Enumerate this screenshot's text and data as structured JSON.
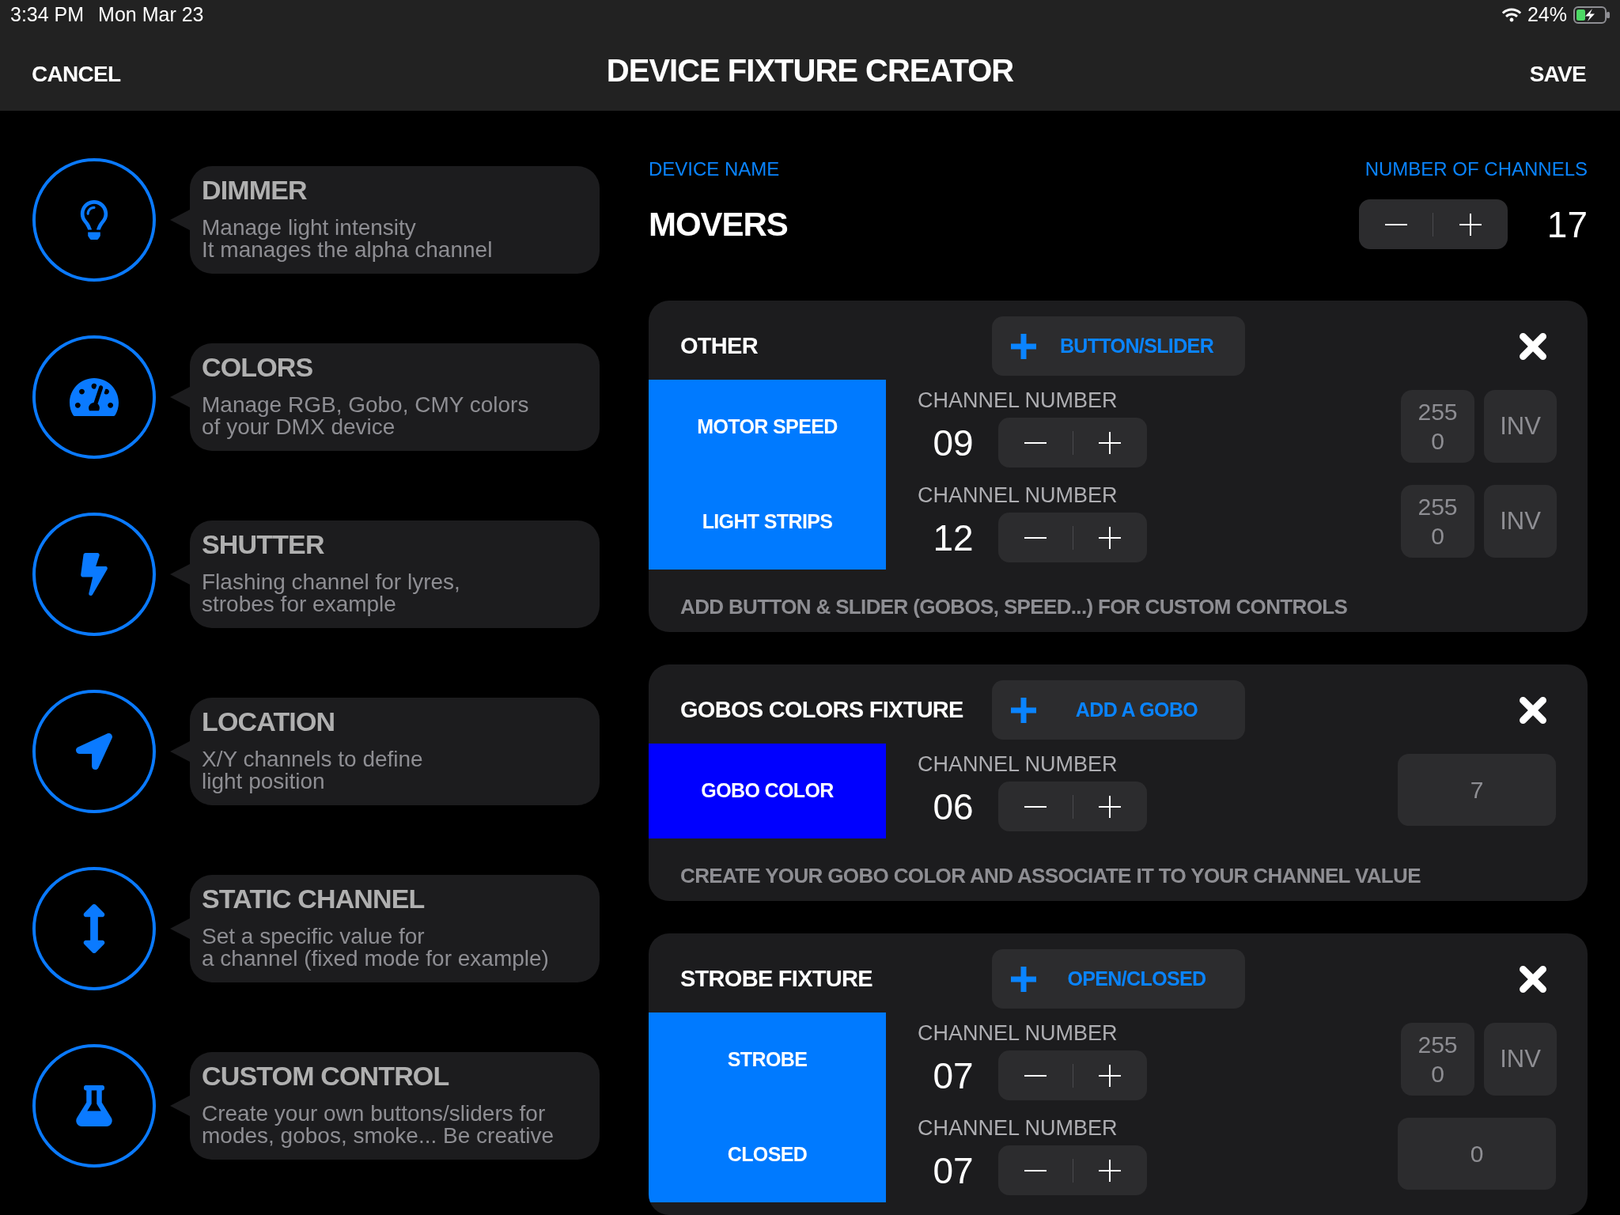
{
  "status_bar": {
    "time": "3:34 PM",
    "date": "Mon Mar 23",
    "battery": "24%"
  },
  "header": {
    "cancel": "CANCEL",
    "title": "DEVICE FIXTURE CREATOR",
    "save": "SAVE"
  },
  "sidebar": {
    "items": [
      {
        "title": "DIMMER",
        "description": "Manage light intensity\nIt manages the alpha channel"
      },
      {
        "title": "COLORS",
        "description": "Manage RGB, Gobo, CMY colors\nof your DMX device"
      },
      {
        "title": "SHUTTER",
        "description": "Flashing channel for lyres,\nstrobes for example"
      },
      {
        "title": "LOCATION",
        "description": "X/Y channels to define\nlight position"
      },
      {
        "title": "STATIC CHANNEL",
        "description": "Set a specific value for\na channel (fixed mode for example)"
      },
      {
        "title": "CUSTOM CONTROL",
        "description": "Create your own buttons/sliders for\nmodes, gobos, smoke... Be creative"
      }
    ]
  },
  "device": {
    "name_label": "DEVICE NAME",
    "name": "MOVERS",
    "channels_label": "NUMBER OF CHANNELS",
    "channels": "17"
  },
  "sections": [
    {
      "title": "OTHER",
      "add_button": "BUTTON/SLIDER",
      "rows": [
        {
          "label": "MOTOR SPEED",
          "color": "#007aff",
          "channel_label": "CHANNEL NUMBER",
          "channel": "09",
          "kind": "range",
          "max": "255",
          "min": "0",
          "invert": "INV"
        },
        {
          "label": "LIGHT STRIPS",
          "color": "#007aff",
          "channel_label": "CHANNEL NUMBER",
          "channel": "12",
          "kind": "range",
          "max": "255",
          "min": "0",
          "invert": "INV"
        }
      ],
      "hint": "ADD BUTTON & SLIDER (GOBOS, SPEED...) FOR CUSTOM CONTROLS"
    },
    {
      "title": "GOBOS COLORS FIXTURE",
      "add_button": "ADD A GOBO",
      "rows": [
        {
          "label": "GOBO COLOR",
          "color": "#0000ff",
          "channel_label": "CHANNEL NUMBER",
          "channel": "06",
          "kind": "value",
          "value": "7"
        }
      ],
      "hint": "CREATE YOUR GOBO COLOR AND ASSOCIATE IT TO YOUR CHANNEL VALUE"
    },
    {
      "title": "STROBE FIXTURE",
      "add_button": "OPEN/CLOSED",
      "rows": [
        {
          "label": "STROBE",
          "color": "#007aff",
          "channel_label": "CHANNEL NUMBER",
          "channel": "07",
          "kind": "range",
          "max": "255",
          "min": "0",
          "invert": "INV"
        },
        {
          "label": "CLOSED",
          "color": "#007aff",
          "channel_label": "CHANNEL NUMBER",
          "channel": "07",
          "kind": "value",
          "value": "0"
        }
      ]
    }
  ]
}
